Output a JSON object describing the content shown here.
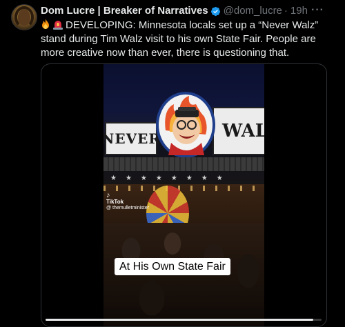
{
  "tweet": {
    "author_name": "Dom Lucre | Breaker of Narratives",
    "handle": "@dom_lucre",
    "separator": "·",
    "time": "19h",
    "more": "···",
    "text_prefix_icons": [
      "fire-emoji",
      "siren-emoji"
    ],
    "text": "DEVELOPING: Minnesota locals set up a “Never Walz” stand during Tim Walz visit to his own State Fair. People are more creative now than ever, there is questioning that."
  },
  "media": {
    "sign_left": "NEVER",
    "sign_right": "WAL",
    "watermark_brand": "TikTok",
    "watermark_user": "@ themulletminister",
    "caption": "At His Own State Fair",
    "progress": 0.97
  },
  "colors": {
    "background": "#000000",
    "text": "#e7e9ea",
    "secondary": "#71767b",
    "verified": "#1d9bf0"
  }
}
